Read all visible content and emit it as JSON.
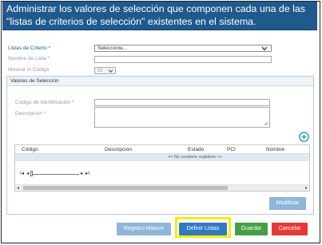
{
  "header": {
    "title": "Administrar los valores de selección que componen cada una de las \"listas de criterios de selección\" existentes en el sistema."
  },
  "form": {
    "criteria_label": "Listas de Criterio *",
    "criteria_value": "Seleccione...",
    "list_name_label": "Nombre de Lista *",
    "list_name_value": "",
    "show_code_label": "Mostrar el Código",
    "show_code_value": "SI"
  },
  "selection_values": {
    "panel_title": "Valores de Selección",
    "code_label": "Código de Identificación *",
    "description_label": "Descripción *",
    "code_value": "",
    "description_value": ""
  },
  "grid": {
    "columns": [
      "Código",
      "Descripción",
      "Estado",
      "PCI",
      "Nombre"
    ],
    "empty_message": "<< No contiene registros >>",
    "pager": {
      "first": "I◂",
      "prev": "◂",
      "next": "▸",
      "last": "▸I"
    }
  },
  "buttons": {
    "modify": "Modificar",
    "bulk_register": "Registro Masivo",
    "define_lists": "Definir Listas",
    "save": "Guardar",
    "cancel": "Cancelar"
  },
  "colors": {
    "header_bg": "#1f5a8e",
    "primary": "#3378c4",
    "disabled": "#8fb5d8",
    "save": "#43a047",
    "cancel": "#e53935",
    "highlight": "#f3ee00"
  },
  "icons": {
    "add": "plus-circle-icon",
    "dropdown": "chevron-down-icon"
  }
}
